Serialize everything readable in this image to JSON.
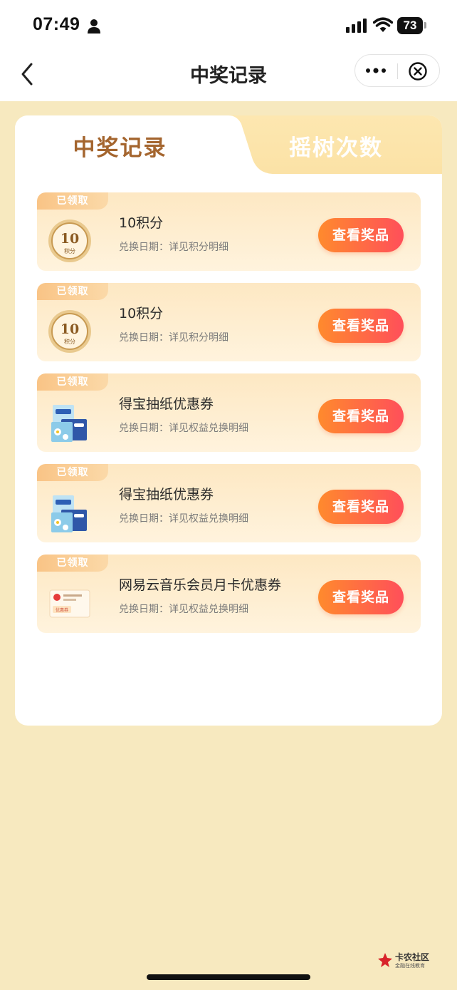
{
  "status_bar": {
    "time": "07:49",
    "battery": "73"
  },
  "nav": {
    "title": "中奖记录"
  },
  "tabs": [
    {
      "label": "中奖记录",
      "active": true
    },
    {
      "label": "摇树次数",
      "active": false
    }
  ],
  "records": [
    {
      "tag": "已领取",
      "title": "10积分",
      "subtitle": "兑换日期：详见积分明细",
      "image": "coin-10-points",
      "coin_value": "10",
      "coin_unit": "积分",
      "button": "查看奖品"
    },
    {
      "tag": "已领取",
      "title": "10积分",
      "subtitle": "兑换日期：详见积分明细",
      "image": "coin-10-points",
      "coin_value": "10",
      "coin_unit": "积分",
      "button": "查看奖品"
    },
    {
      "tag": "已领取",
      "title": "得宝抽纸优惠券",
      "subtitle": "兑换日期：详见权益兑换明细",
      "image": "tissue-pack",
      "button": "查看奖品"
    },
    {
      "tag": "已领取",
      "title": "得宝抽纸优惠券",
      "subtitle": "兑换日期：详见权益兑换明细",
      "image": "tissue-pack",
      "button": "查看奖品"
    },
    {
      "tag": "已领取",
      "title": "网易云音乐会员月卡优惠券",
      "subtitle": "兑换日期：详见权益兑换明细",
      "image": "music-coupon",
      "coupon_label": "优惠券",
      "button": "查看奖品"
    }
  ],
  "watermark": {
    "title": "卡农社区",
    "subtitle": "金融在线教育"
  },
  "colors": {
    "page_bg": "#f7e9bf",
    "accent": "#ff5a50",
    "tab_active_text": "#a4652e"
  }
}
